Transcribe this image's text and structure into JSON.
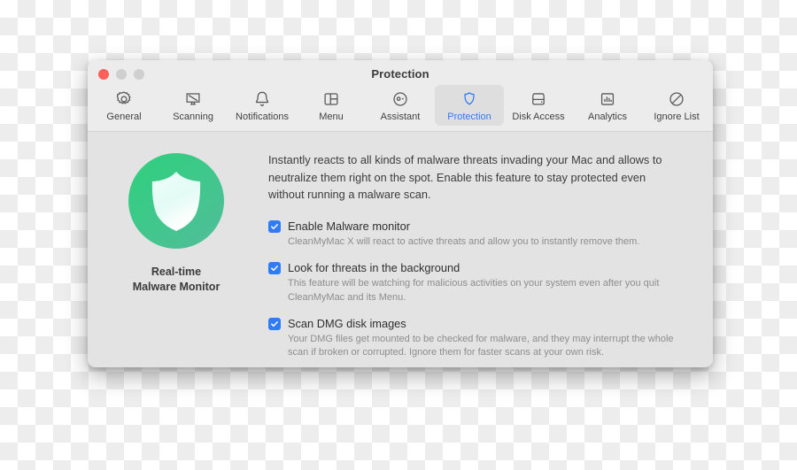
{
  "window": {
    "title": "Protection",
    "traffic_lights": [
      {
        "name": "close",
        "color": "#fc6058"
      },
      {
        "name": "minimize",
        "color": "#cfcfcf"
      },
      {
        "name": "maximize",
        "color": "#cfcfcf"
      }
    ]
  },
  "toolbar": {
    "active_tab": "Protection",
    "accent_color": "#2f7cf6",
    "tabs": [
      {
        "label": "General",
        "icon": "gear-icon"
      },
      {
        "label": "Scanning",
        "icon": "monitor-scan-icon"
      },
      {
        "label": "Notifications",
        "icon": "bell-icon"
      },
      {
        "label": "Menu",
        "icon": "window-layout-icon"
      },
      {
        "label": "Assistant",
        "icon": "assistant-face-icon"
      },
      {
        "label": "Protection",
        "icon": "shield-icon"
      },
      {
        "label": "Disk Access",
        "icon": "hard-drive-icon"
      },
      {
        "label": "Analytics",
        "icon": "bar-chart-icon"
      },
      {
        "label": "Ignore List",
        "icon": "prohibition-icon"
      }
    ]
  },
  "sidebar": {
    "badge_icon": "shield-icon",
    "badge_gradient_from": "#2ecf7c",
    "badge_gradient_to": "#52bc9c",
    "title_line1": "Real-time",
    "title_line2": "Malware Monitor"
  },
  "main": {
    "description": "Instantly reacts to all kinds of malware threats invading your Mac and allows to neutralize them right on the spot. Enable this feature to stay protected even without running a malware scan.",
    "options": [
      {
        "label": "Enable Malware monitor",
        "description": "CleanMyMac X will react to active threats and allow you to instantly remove them.",
        "checked": true
      },
      {
        "label": "Look for threats in the background",
        "description": "This feature will be watching for malicious activities on your system even after you quit CleanMyMac and its Menu.",
        "checked": true
      },
      {
        "label": "Scan DMG disk images",
        "description": "Your DMG files get mounted to be checked for malware, and they may interrupt the whole scan if broken or corrupted. Ignore them for faster scans at your own risk.",
        "checked": true
      }
    ]
  }
}
